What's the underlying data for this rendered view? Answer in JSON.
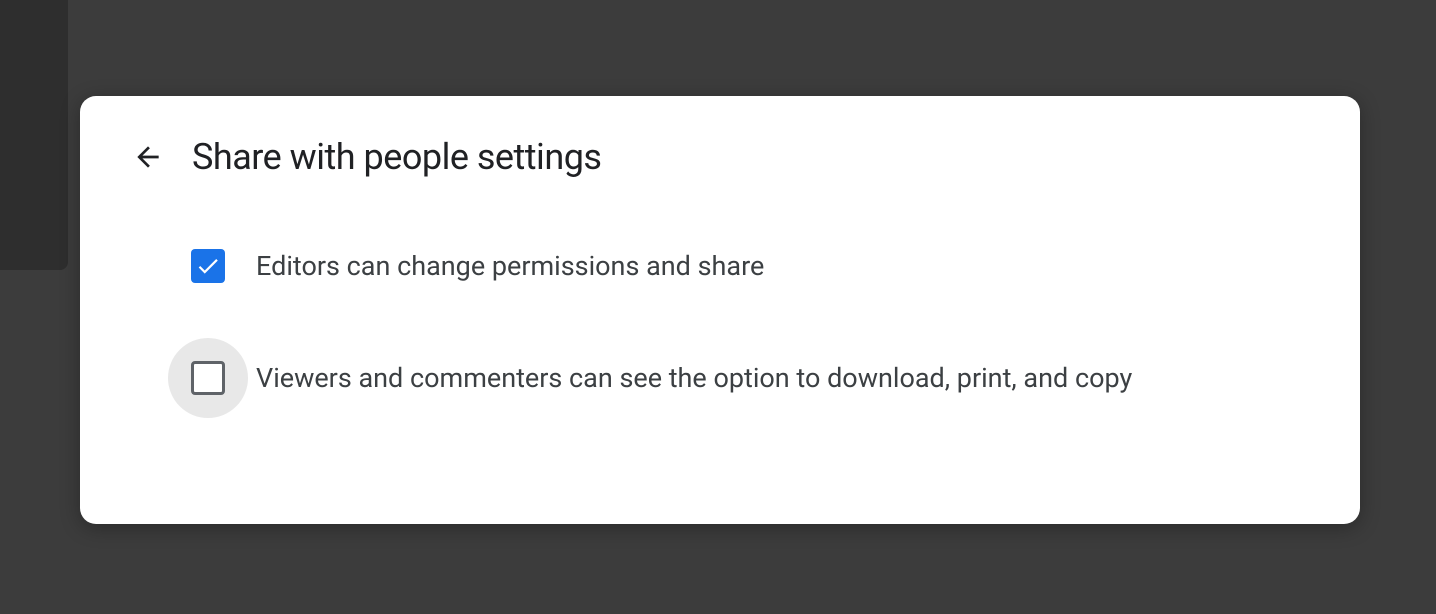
{
  "dialog": {
    "title": "Share with people settings",
    "options": [
      {
        "label": "Editors can change permissions and share",
        "checked": true,
        "hovered": false
      },
      {
        "label": "Viewers and commenters can see the option to download, print, and copy",
        "checked": false,
        "hovered": true
      }
    ]
  }
}
